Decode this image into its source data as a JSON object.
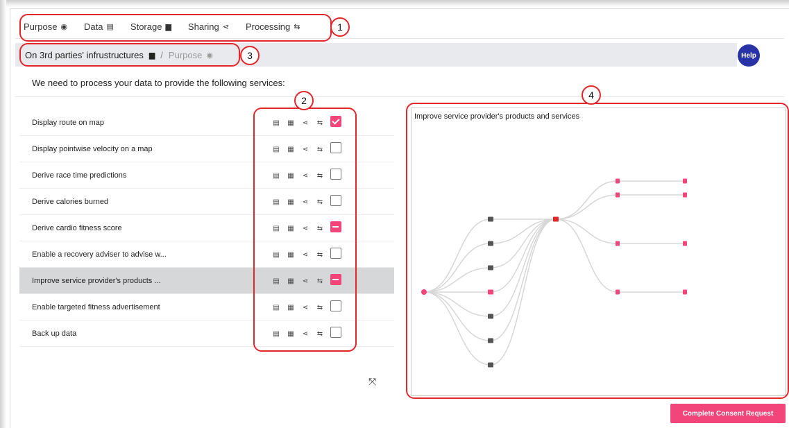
{
  "tabs": [
    {
      "label": "Purpose",
      "icon": "target-icon",
      "glyph": "◉"
    },
    {
      "label": "Data",
      "icon": "id-card-icon",
      "glyph": "▤"
    },
    {
      "label": "Storage",
      "icon": "archive-icon",
      "glyph": "▆"
    },
    {
      "label": "Sharing",
      "icon": "share-icon",
      "glyph": "⋖"
    },
    {
      "label": "Processing",
      "icon": "processing-icon",
      "glyph": "⇆"
    }
  ],
  "callouts": {
    "one": "1",
    "two": "2",
    "three": "3",
    "four": "4"
  },
  "breadcrumb": {
    "first": "On 3rd parties' infrustructures",
    "first_glyph": "▆",
    "separator": "/",
    "second": "Purpose",
    "second_glyph": "◉"
  },
  "help_label": "Help",
  "intro": "We need to process your data to provide the following services:",
  "services": [
    {
      "label": "Display route on map",
      "state": "checked",
      "selected": false
    },
    {
      "label": "Display pointwise velocity on a map",
      "state": "unchecked",
      "selected": false
    },
    {
      "label": "Derive race time predictions",
      "state": "unchecked",
      "selected": false
    },
    {
      "label": "Derive calories burned",
      "state": "unchecked",
      "selected": false
    },
    {
      "label": "Derive cardio fitness score",
      "state": "partial",
      "selected": false
    },
    {
      "label": "Enable a recovery adviser to advise w...",
      "state": "unchecked",
      "selected": false
    },
    {
      "label": "Improve service provider's products ...",
      "state": "partial",
      "selected": true
    },
    {
      "label": "Enable targeted fitness advertisement",
      "state": "unchecked",
      "selected": false
    },
    {
      "label": "Back up data",
      "state": "unchecked",
      "selected": false
    }
  ],
  "row_icons": [
    "▤",
    "▦",
    "⋖",
    "⇆"
  ],
  "graph": {
    "title": "Improve service provider's products and services",
    "accent": "#f2467a",
    "link_color": "#d7d7d7"
  },
  "expand_glyph": "⤧",
  "complete_label": "Complete Consent Request",
  "colors": {
    "callout": "#e3262a",
    "accent": "#f2467a",
    "help": "#2833a8"
  }
}
